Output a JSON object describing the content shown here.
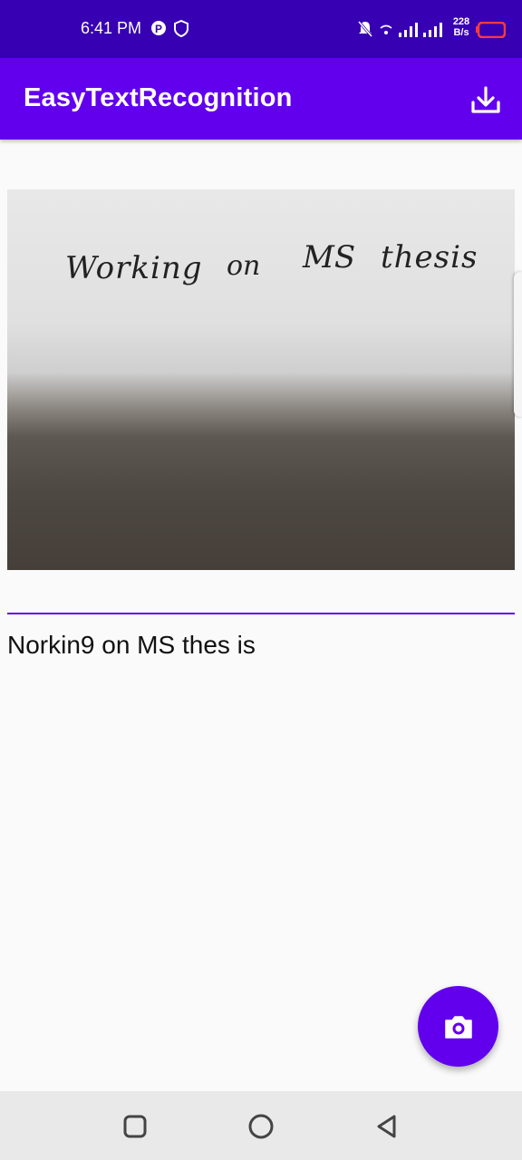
{
  "status_bar": {
    "time": "6:41 PM",
    "speed_value": "228",
    "speed_unit": "B/s",
    "icons": [
      "p-app-icon",
      "shield-icon",
      "bell-off-icon",
      "wifi-icon",
      "signal-icon",
      "signal-icon",
      "battery-icon"
    ]
  },
  "app_bar": {
    "title": "EasyTextRecognition",
    "action_icon": "download-icon"
  },
  "photo": {
    "handwriting": [
      "Working",
      "on",
      "MS",
      "thesis"
    ]
  },
  "result": {
    "text": "Norkin9 on MS thes is"
  },
  "fab": {
    "icon": "camera-icon",
    "color": "#6200ee"
  },
  "nav_bar": {
    "buttons": [
      "recents",
      "home",
      "back"
    ]
  },
  "colors": {
    "primary": "#6200ee",
    "primary_dark": "#3700b3"
  }
}
